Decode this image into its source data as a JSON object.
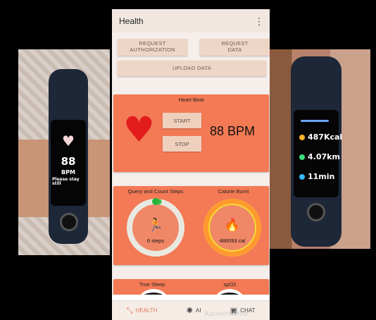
{
  "app": {
    "title": "Health",
    "menu_icon": "more-vert-icon"
  },
  "actions": {
    "request_authorization": "REQUEST\nAUTHORIZATION",
    "request_data": "REQUEST\nDATA",
    "upload_data": "UPLOAD DATA"
  },
  "heart_beat": {
    "title": "Heart Beat",
    "start_label": "START",
    "stop_label": "STOP",
    "bpm_text": "88 BPM"
  },
  "steps": {
    "title": "Query and Count Steps",
    "value_text": "6 steps",
    "progress": 0.02
  },
  "calories": {
    "title": "Calorie Burnt",
    "value_text": "486093 cal",
    "progress": 1.0
  },
  "sleep": {
    "title": "True Sleep"
  },
  "spo2": {
    "title": "spO2"
  },
  "nav": {
    "items": [
      {
        "label": "HEALTH",
        "icon": "health-icon",
        "active": true
      },
      {
        "label": "AI",
        "icon": "ai-icon",
        "active": false
      },
      {
        "label": "CHAT",
        "icon": "chat-icon",
        "active": false
      }
    ]
  },
  "left_watch": {
    "value": "88",
    "unit": "BPM",
    "message": "Please stay\nstill"
  },
  "right_watch": {
    "calories": "487Kcal",
    "distance": "4.07km",
    "time": "11min"
  },
  "watermark": "ApowerMirror",
  "colors": {
    "card": "#f37a55",
    "ring_green": "#39c04a",
    "ring_orange": "#ff9a2e",
    "accent": "#e07a55"
  }
}
